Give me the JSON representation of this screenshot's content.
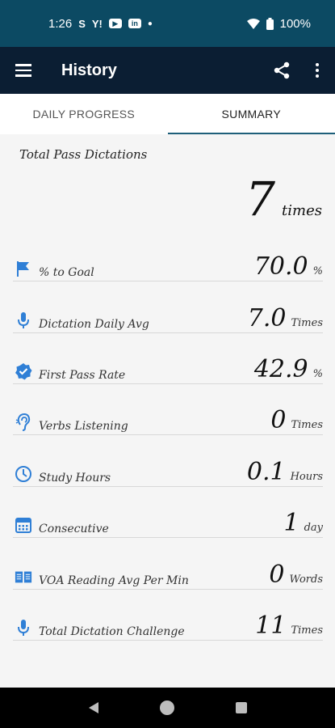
{
  "status_bar": {
    "time": "1:26",
    "icons": [
      "s-icon",
      "yahoo-icon",
      "youtube-icon",
      "linkedin-icon",
      "dot-icon"
    ],
    "battery": "100%"
  },
  "app_bar": {
    "title": "History"
  },
  "tabs": [
    {
      "label": "DAILY PROGRESS",
      "active": false
    },
    {
      "label": "SUMMARY",
      "active": true
    }
  ],
  "summary": {
    "total_label": "Total Pass Dictations",
    "total_value": "7",
    "total_unit": "times",
    "stats": [
      {
        "icon": "flag-icon",
        "label": "% to Goal",
        "value": "70.0",
        "unit": "%"
      },
      {
        "icon": "microphone-icon",
        "label": "Dictation Daily Avg",
        "value": "7.0",
        "unit": "Times"
      },
      {
        "icon": "verified-badge-icon",
        "label": "First Pass Rate",
        "value": "42.9",
        "unit": "%"
      },
      {
        "icon": "ear-icon",
        "label": "Verbs Listening",
        "value": "0",
        "unit": "Times"
      },
      {
        "icon": "clock-icon",
        "label": "Study Hours",
        "value": "0.1",
        "unit": "Hours"
      },
      {
        "icon": "calendar-icon",
        "label": "Consecutive",
        "value": "1",
        "unit": "day"
      },
      {
        "icon": "book-icon",
        "label": "VOA Reading Avg Per Min",
        "value": "0",
        "unit": "Words"
      },
      {
        "icon": "microphone-icon",
        "label": "Total Dictation Challenge",
        "value": "11",
        "unit": "Times"
      }
    ]
  },
  "colors": {
    "status_bar": "#0c4a63",
    "app_bar": "#0b1e33",
    "accent": "#2f7fd6"
  }
}
